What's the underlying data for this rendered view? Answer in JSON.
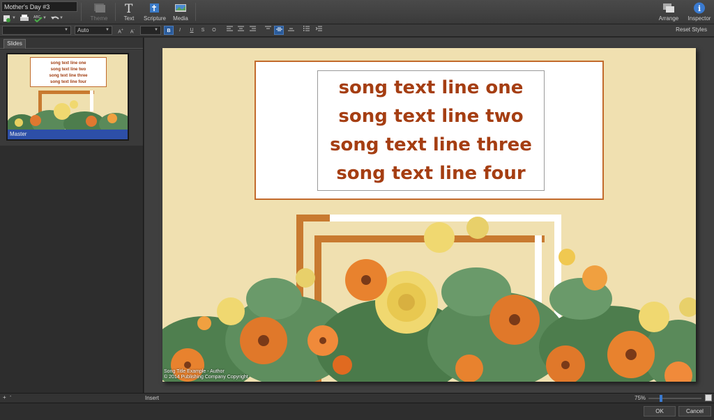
{
  "app": {
    "document_title": "Mother's Day #3"
  },
  "toolbar": {
    "theme_label": "Theme",
    "text_label": "Text",
    "scripture_label": "Scripture",
    "media_label": "Media",
    "arrange_label": "Arrange",
    "inspector_label": "Inspector"
  },
  "format_bar": {
    "font_name": "",
    "font_size": "Auto",
    "bold_label": "B",
    "italic_label": "I",
    "underline_label": "U",
    "strike_label": "S",
    "outline_label": "O",
    "reset_styles_label": "Reset Styles"
  },
  "left_panel": {
    "tab_label": "Slides",
    "slides": [
      {
        "label": "Master",
        "lines": [
          "song text line one",
          "song text line two",
          "song text line three",
          "song text line four"
        ]
      }
    ]
  },
  "slide": {
    "lines": [
      "song text line one",
      "song text line two",
      "song text line three",
      "song text line four"
    ],
    "credit_line_1": "Song Title Example - Author",
    "credit_line_2": "© 2014 Publishing Company Copyright",
    "colors": {
      "background": "#f0e0b0",
      "text": "#a53e12",
      "frame": "#c26a2c"
    }
  },
  "status": {
    "insert_label": "Insert",
    "zoom": "75%"
  },
  "dialog": {
    "ok_label": "OK",
    "cancel_label": "Cancel"
  }
}
